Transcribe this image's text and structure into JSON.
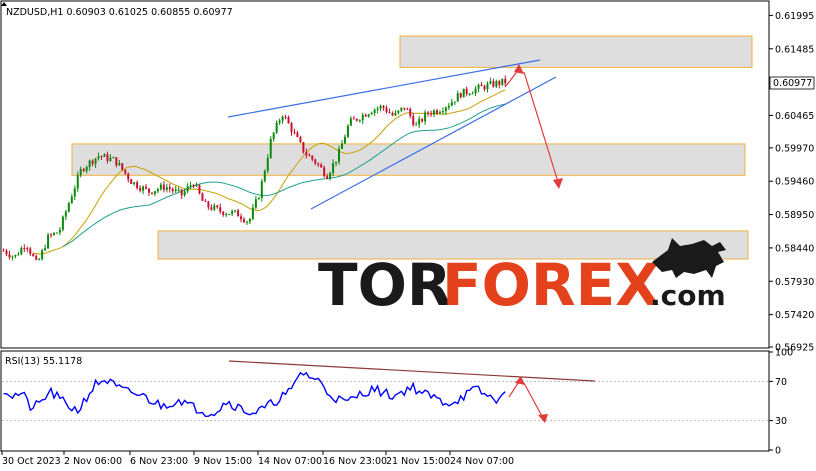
{
  "header": {
    "symbol_line": "NZDUSD,H1  0.60903 0.61025 0.60855 0.60977"
  },
  "price_panel": {
    "y_ticks": [
      "0.61995",
      "0.61485",
      "0.60465",
      "0.59970",
      "0.59460",
      "0.58950",
      "0.58440",
      "0.57930",
      "0.57420",
      "0.56925"
    ],
    "current_price": "0.60977"
  },
  "rsi_panel": {
    "label": "RSI(13) 55.1178",
    "y_ticks": [
      "100",
      "70",
      "30",
      "0"
    ]
  },
  "x_axis": {
    "labels": [
      "30 Oct 2023",
      "2 Nov 06:00",
      "6 Nov 23:00",
      "9 Nov 15:00",
      "14 Nov 07:00",
      "16 Nov 23:00",
      "21 Nov 15:00",
      "24 Nov 07:00"
    ]
  },
  "watermark": {
    "part1": "TOR",
    "part2": "FOREX",
    "part3": ".com"
  },
  "colors": {
    "bull_candle": "#0a8a0a",
    "bear_candle": "#c8102e",
    "ma_fast": "#c9a100",
    "ma_slow": "#20a090",
    "trendline": "#3a6ee8",
    "forecast_arrow": "#e23b3b",
    "zone_fill": "#dedede",
    "zone_border": "#f0b040",
    "rsi_line": "#0000ff",
    "rsi_trendline": "#8b3a3a",
    "logo_dark": "#1a1a1a",
    "logo_red": "#e4421c"
  },
  "chart_data": [
    {
      "type": "candlestick",
      "title": "NZDUSD,H1",
      "ohlc_last": {
        "open": 0.60903,
        "high": 0.61025,
        "low": 0.60855,
        "close": 0.60977
      },
      "ylim": [
        0.56925,
        0.622
      ],
      "x_categories": [
        "30 Oct 2023",
        "2 Nov 06:00",
        "6 Nov 23:00",
        "9 Nov 15:00",
        "14 Nov 07:00",
        "16 Nov 23:00",
        "21 Nov 15:00",
        "24 Nov 07:00"
      ],
      "close_path": [
        [
          0,
          0.584
        ],
        [
          0.02,
          0.583
        ],
        [
          0.04,
          0.5852
        ],
        [
          0.06,
          0.5818
        ],
        [
          0.08,
          0.586
        ],
        [
          0.1,
          0.587
        ],
        [
          0.12,
          0.592
        ],
        [
          0.14,
          0.5965
        ],
        [
          0.17,
          0.5985
        ],
        [
          0.2,
          0.5978
        ],
        [
          0.23,
          0.5945
        ],
        [
          0.26,
          0.593
        ],
        [
          0.29,
          0.5938
        ],
        [
          0.32,
          0.5925
        ],
        [
          0.34,
          0.5945
        ],
        [
          0.36,
          0.591
        ],
        [
          0.39,
          0.59
        ],
        [
          0.42,
          0.5896
        ],
        [
          0.44,
          0.5884
        ],
        [
          0.46,
          0.593
        ],
        [
          0.48,
          0.601
        ],
        [
          0.5,
          0.605
        ],
        [
          0.52,
          0.602
        ],
        [
          0.54,
          0.599
        ],
        [
          0.56,
          0.5975
        ],
        [
          0.58,
          0.5955
        ],
        [
          0.6,
          0.5985
        ],
        [
          0.62,
          0.6035
        ],
        [
          0.64,
          0.6045
        ],
        [
          0.66,
          0.6055
        ],
        [
          0.68,
          0.606
        ],
        [
          0.7,
          0.6045
        ],
        [
          0.72,
          0.606
        ],
        [
          0.74,
          0.603
        ],
        [
          0.76,
          0.605
        ],
        [
          0.78,
          0.6055
        ],
        [
          0.8,
          0.6065
        ],
        [
          0.82,
          0.608
        ],
        [
          0.84,
          0.6085
        ],
        [
          0.86,
          0.609
        ],
        [
          0.88,
          0.6095
        ],
        [
          0.9,
          0.6098
        ]
      ],
      "zones": [
        {
          "low": 0.612,
          "high": 0.6168
        },
        {
          "low": 0.5955,
          "high": 0.6003
        },
        {
          "low": 0.5827,
          "high": 0.587
        }
      ]
    },
    {
      "type": "line",
      "title": "RSI(13) 55.1178",
      "ylim": [
        0,
        100
      ],
      "levels": [
        70,
        30
      ],
      "values": [
        62,
        55,
        58,
        42,
        48,
        60,
        52,
        45,
        40,
        55,
        68,
        72,
        65,
        60,
        58,
        55,
        50,
        45,
        48,
        52,
        45,
        42,
        38,
        40,
        50,
        45,
        40,
        38,
        42,
        48,
        55,
        60,
        80,
        75,
        70,
        58,
        52,
        48,
        55,
        60,
        62,
        58,
        55,
        60,
        65,
        58,
        55,
        50,
        48,
        52,
        58,
        62,
        55,
        52,
        55
      ]
    }
  ]
}
